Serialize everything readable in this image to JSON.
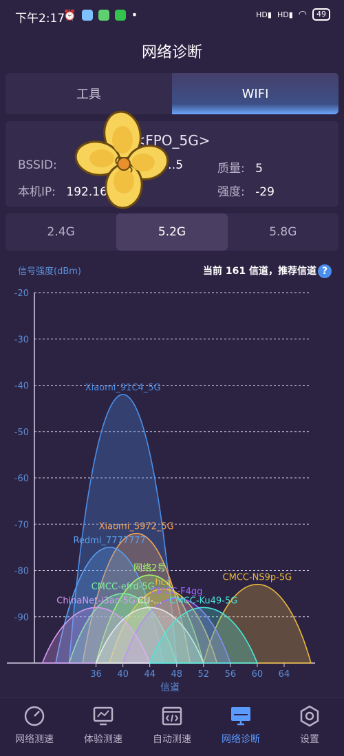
{
  "status": {
    "time": "下午2:17",
    "battery": "49",
    "signal1": "HD",
    "signal2": "HD"
  },
  "title": "网络诊断",
  "tabs": [
    {
      "label": "工具"
    },
    {
      "label": "WIFI"
    }
  ],
  "info": {
    "ssid": "<FPO_5G>",
    "bssid_label": "BSSID:",
    "bssid_value": "…5",
    "quality_label": "质量:",
    "quality_value": "5",
    "ip_label": "本机IP:",
    "ip_value": "192.16…2",
    "strength_label": "强度:",
    "strength_value": "-29"
  },
  "bands": [
    {
      "label": "2.4G"
    },
    {
      "label": "5.2G"
    },
    {
      "label": "5.8G"
    }
  ],
  "chart_header": {
    "ylabel": "信号强度(dBm)",
    "current": "当前 161 信道，推荐信道"
  },
  "chart_data": {
    "type": "area",
    "ylabel": "信号强度(dBm)",
    "xlabel": "信道",
    "ylim": [
      -100,
      -20
    ],
    "yticks": [
      -20,
      -30,
      -40,
      -50,
      -60,
      -70,
      -80,
      -90
    ],
    "xticks": [
      36,
      40,
      44,
      48,
      52,
      56,
      60,
      64
    ],
    "series": [
      {
        "name": "Xiaomi_91C4_5G",
        "center": 40,
        "width": 16,
        "peak": -42,
        "color": "#4a8fe8"
      },
      {
        "name": "Xiaomi_5972_5G",
        "center": 42,
        "width": 16,
        "peak": -72,
        "color": "#f4a35c"
      },
      {
        "name": "Redmi_7777777",
        "center": 38,
        "width": 16,
        "peak": -75,
        "color": "#5aa0f0"
      },
      {
        "name": "网络2号",
        "center": 44,
        "width": 16,
        "peak": -81,
        "color": "#a6f56b"
      },
      {
        "name": "hca",
        "center": 46,
        "width": 16,
        "peak": -84,
        "color": "#f0c040"
      },
      {
        "name": "CMCC-NS9p-5G",
        "center": 60,
        "width": 16,
        "peak": -83,
        "color": "#e8b83c"
      },
      {
        "name": "CMCC-efrd-5G",
        "center": 40,
        "width": 16,
        "peak": -85,
        "color": "#7cf0a0"
      },
      {
        "name": "CMCC-F4gg",
        "center": 48,
        "width": 16,
        "peak": -86,
        "color": "#9b6bff"
      },
      {
        "name": "ChinaNet-i3ac-5G",
        "center": 36,
        "width": 16,
        "peak": -88,
        "color": "#d69cf0"
      },
      {
        "name": "CU-...",
        "center": 44,
        "width": 16,
        "peak": -88,
        "color": "#e8e8e8"
      },
      {
        "name": "CMCC-Ku49-5G",
        "center": 52,
        "width": 16,
        "peak": -88,
        "color": "#48e8d8"
      }
    ]
  },
  "nav": [
    {
      "label": "网络测速",
      "icon": "gauge-icon"
    },
    {
      "label": "体验测速",
      "icon": "monitor-chart-icon"
    },
    {
      "label": "自动测速",
      "icon": "code-window-icon"
    },
    {
      "label": "网络诊断",
      "icon": "computer-icon"
    },
    {
      "label": "设置",
      "icon": "hexagon-settings-icon"
    }
  ],
  "colors": {
    "background": "#2c2242",
    "panel": "#352b4d",
    "accent": "#5b9bff"
  }
}
